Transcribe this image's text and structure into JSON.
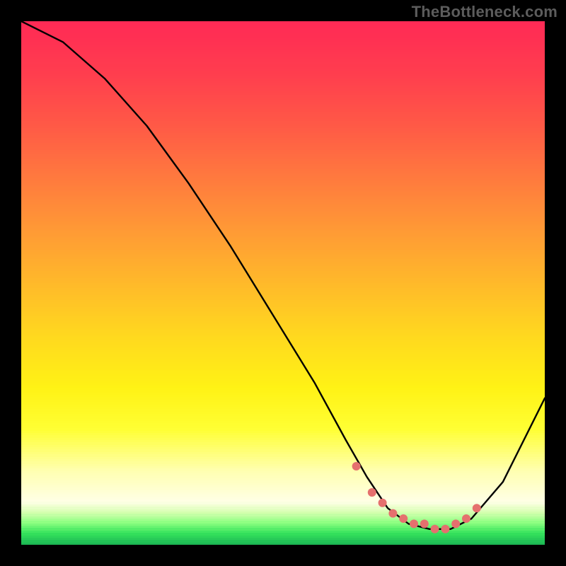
{
  "watermark": "TheBottleneck.com",
  "chart_data": {
    "type": "line",
    "title": "",
    "xlabel": "",
    "ylabel": "",
    "xlim": [
      0,
      100
    ],
    "ylim": [
      0,
      100
    ],
    "background_gradient": [
      {
        "stop": 0,
        "color": "#ff2a55"
      },
      {
        "stop": 10,
        "color": "#ff3e4e"
      },
      {
        "stop": 20,
        "color": "#ff5a46"
      },
      {
        "stop": 30,
        "color": "#ff7a3e"
      },
      {
        "stop": 40,
        "color": "#ff9a35"
      },
      {
        "stop": 50,
        "color": "#ffb92a"
      },
      {
        "stop": 60,
        "color": "#ffd81f"
      },
      {
        "stop": 70,
        "color": "#fff215"
      },
      {
        "stop": 78,
        "color": "#ffff33"
      },
      {
        "stop": 86,
        "color": "#ffffb0"
      },
      {
        "stop": 92,
        "color": "#ffffe6"
      },
      {
        "stop": 94,
        "color": "#d6ffb0"
      },
      {
        "stop": 96,
        "color": "#8cff80"
      },
      {
        "stop": 98,
        "color": "#35e35c"
      },
      {
        "stop": 100,
        "color": "#1db954"
      }
    ],
    "series": [
      {
        "name": "bottleneck-curve",
        "x": [
          0,
          8,
          16,
          24,
          32,
          40,
          48,
          56,
          62,
          66,
          70,
          74,
          78,
          82,
          86,
          92,
          100
        ],
        "y": [
          100,
          96,
          89,
          80,
          69,
          57,
          44,
          31,
          20,
          13,
          7,
          4,
          3,
          3,
          5,
          12,
          28
        ]
      }
    ],
    "points": {
      "name": "optimal-range",
      "color": "#e5706e",
      "x": [
        64,
        67,
        69,
        71,
        73,
        75,
        77,
        79,
        81,
        83,
        85,
        87
      ],
      "y": [
        15,
        10,
        8,
        6,
        5,
        4,
        4,
        3,
        3,
        4,
        5,
        7
      ]
    }
  }
}
